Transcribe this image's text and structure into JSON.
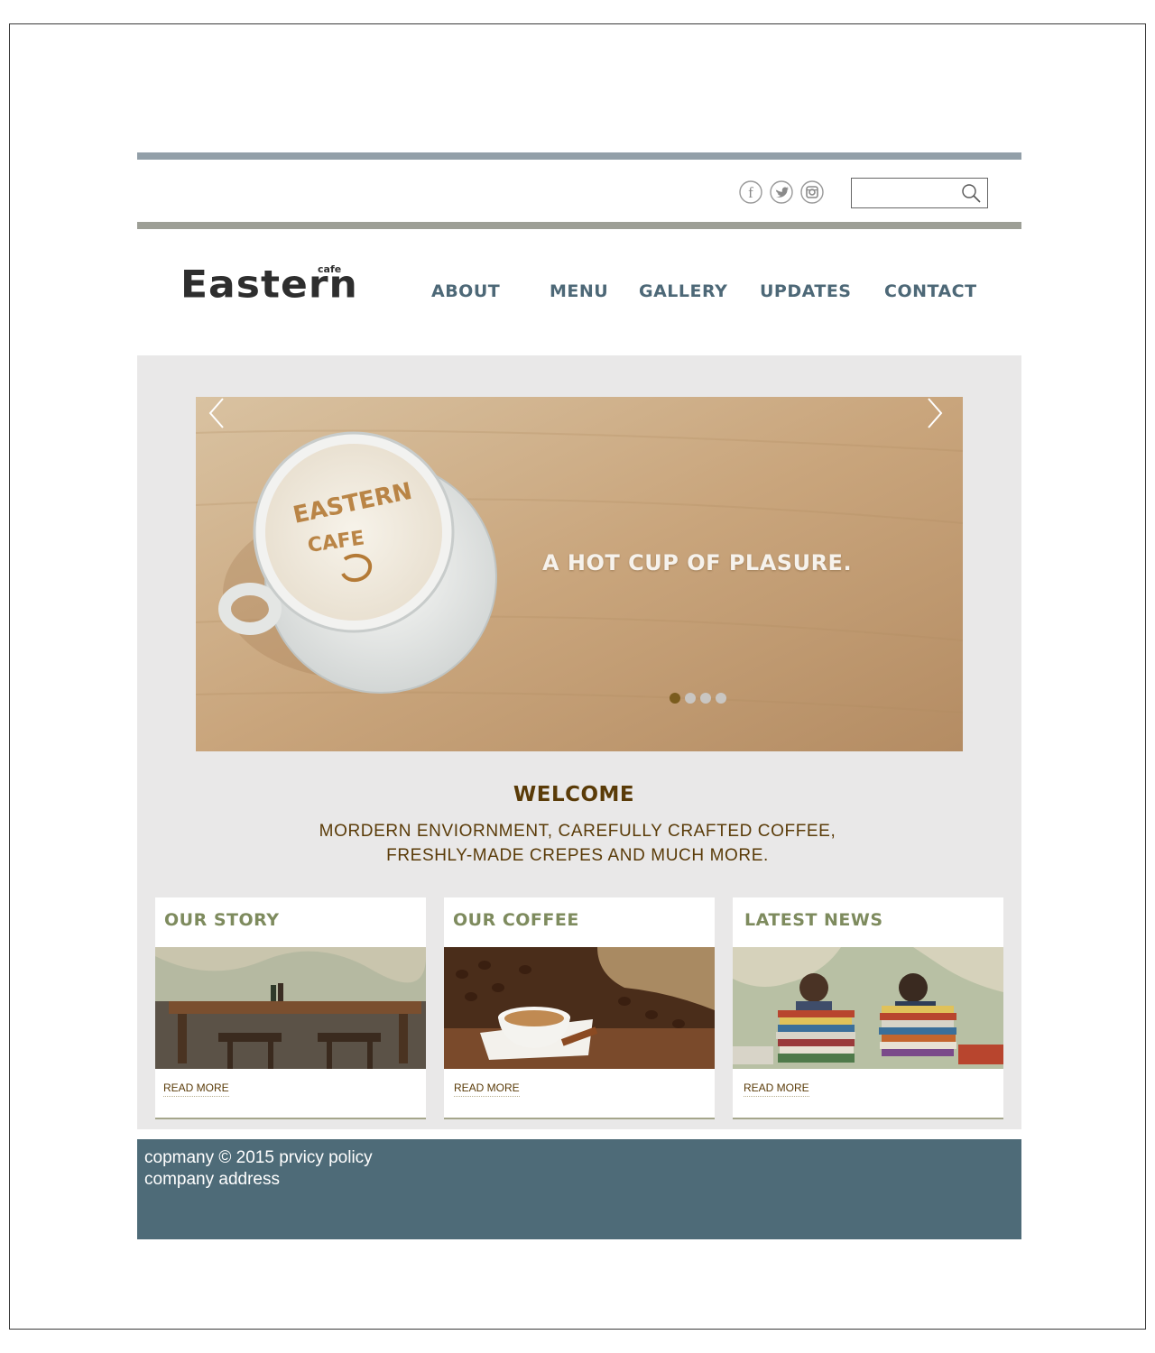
{
  "header": {
    "social": [
      {
        "icon": "facebook-icon",
        "label": "f"
      },
      {
        "icon": "twitter-icon"
      },
      {
        "icon": "instagram-icon"
      }
    ],
    "search": {
      "placeholder": "",
      "value": ""
    }
  },
  "logo": {
    "main": "Eastern",
    "sub": "cafe"
  },
  "nav": {
    "items": [
      "ABOUT",
      "MENU",
      "GALLERY",
      "UPDATES",
      "CONTACT"
    ]
  },
  "hero": {
    "caption": "A HOT CUP OF PLASURE.",
    "slide_count": 4,
    "active_slide": 1,
    "cup_art": {
      "line1": "EASTERN",
      "line2": "CAFE"
    }
  },
  "welcome": {
    "title": "WELCOME",
    "line1": "MORDERN ENVIORNMENT, CAREFULLY CRAFTED COFFEE,",
    "line2": "FRESHLY-MADE CREPES AND MUCH MORE."
  },
  "cards": [
    {
      "title": "OUR STORY",
      "link": "READ MORE"
    },
    {
      "title": "OUR COFFEE",
      "link": "READ MORE"
    },
    {
      "title": "LATEST NEWS",
      "link": "READ MORE"
    }
  ],
  "footer": {
    "line1": "copmany © 2015 prvicy policy",
    "line2": "company address"
  },
  "colors": {
    "nav": "#4d6877",
    "welcome": "#5a3b08",
    "card_title": "#7e8b5e",
    "footer_bg": "#4e6b78",
    "content_bg": "#e9e8e8",
    "dot_active": "#7a5c1e"
  }
}
